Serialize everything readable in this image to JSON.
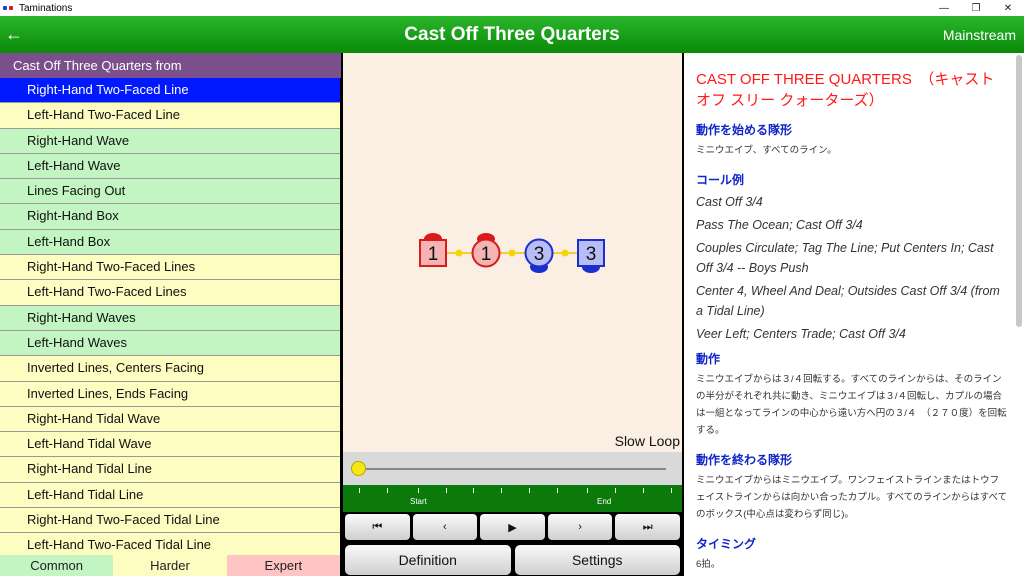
{
  "window": {
    "title": "Taminations",
    "minimize": "—",
    "maximize": "❐",
    "close": "✕"
  },
  "header": {
    "back": "←",
    "title": "Cast Off Three Quarters",
    "level": "Mainstream"
  },
  "list": {
    "heading": "Cast Off Three Quarters from",
    "items": [
      {
        "label": "Right-Hand Two-Faced Line",
        "level": "harder",
        "selected": true
      },
      {
        "label": "Left-Hand Two-Faced Line",
        "level": "harder"
      },
      {
        "label": "Right-Hand Wave",
        "level": "common"
      },
      {
        "label": "Left-Hand Wave",
        "level": "common"
      },
      {
        "label": "Lines Facing Out",
        "level": "common"
      },
      {
        "label": "Right-Hand Box",
        "level": "common"
      },
      {
        "label": "Left-Hand Box",
        "level": "common"
      },
      {
        "label": "Right-Hand Two-Faced Lines",
        "level": "harder"
      },
      {
        "label": "Left-Hand Two-Faced Lines",
        "level": "harder"
      },
      {
        "label": "Right-Hand Waves",
        "level": "common"
      },
      {
        "label": "Left-Hand Waves",
        "level": "common"
      },
      {
        "label": "Inverted Lines, Centers Facing",
        "level": "harder"
      },
      {
        "label": "Inverted Lines, Ends Facing",
        "level": "harder"
      },
      {
        "label": "Right-Hand Tidal Wave",
        "level": "harder"
      },
      {
        "label": "Left-Hand Tidal Wave",
        "level": "harder"
      },
      {
        "label": "Right-Hand Tidal Line",
        "level": "harder"
      },
      {
        "label": "Left-Hand Tidal Line",
        "level": "harder"
      },
      {
        "label": "Right-Hand Two-Faced Tidal Line",
        "level": "harder"
      },
      {
        "label": "Left-Hand Two-Faced Tidal Line",
        "level": "harder"
      }
    ],
    "tabs": [
      {
        "label": "Common",
        "color": "#c2f5c2"
      },
      {
        "label": "Harder",
        "color": "#fdfdc2"
      },
      {
        "label": "Expert",
        "color": "#ffc4c4"
      }
    ]
  },
  "animation": {
    "dancers": [
      {
        "number": "1",
        "shape": "square",
        "color": "#d81b1b",
        "fill": "#f6b3b3"
      },
      {
        "number": "1",
        "shape": "circle",
        "color": "#d81b1b",
        "fill": "#f6b3b3"
      },
      {
        "number": "3",
        "shape": "circle",
        "color": "#1a2fd0",
        "fill": "#b8bef5"
      },
      {
        "number": "3",
        "shape": "square",
        "color": "#1a2fd0",
        "fill": "#b8bef5"
      }
    ],
    "slow_loop": "Slow Loop",
    "progress": 0,
    "start_label": "Start",
    "end_label": "End",
    "controls": [
      "⏮",
      "‹",
      "▶",
      "›",
      "⏭"
    ],
    "definition_button": "Definition",
    "settings_button": "Settings"
  },
  "definition": {
    "title": "CAST OFF THREE QUARTERS　（キャスト オフ スリー クォーターズ）",
    "start_heading": "動作を始める隊形",
    "start_text": "ミニウエイブ、すべてのライン。",
    "examples_heading": "コール例",
    "examples": [
      "Cast Off 3/4",
      "Pass The Ocean; Cast Off 3/4",
      "Couples Circulate; Tag The Line; Put Centers In; Cast Off 3/4 -- Boys Push",
      "Center 4, Wheel And Deal; Outsides Cast Off 3/4 (from a Tidal Line)",
      "Veer Left; Centers Trade; Cast Off 3/4"
    ],
    "action_heading": "動作",
    "action_text": "ミニウエイブからは３/４回転する。すべてのラインからは、そのラインの半分がそれぞれ共に動き、ミニウエイブは３/４回転し、カプルの場合は一組となってラインの中心から遠い方へ円の３/４　（２７０度）を回転する。",
    "end_heading": "動作を終わる隊形",
    "end_text": "ミニウエイブからはミニウエイブ。ワンフェイストラインまたはトウフェイストラインからは向かい合ったカプル。すべてのラインからはすべてのボックス(中心点は変わらず同じ)。",
    "timing_heading": "タイミング",
    "timing_text": "6拍。"
  }
}
